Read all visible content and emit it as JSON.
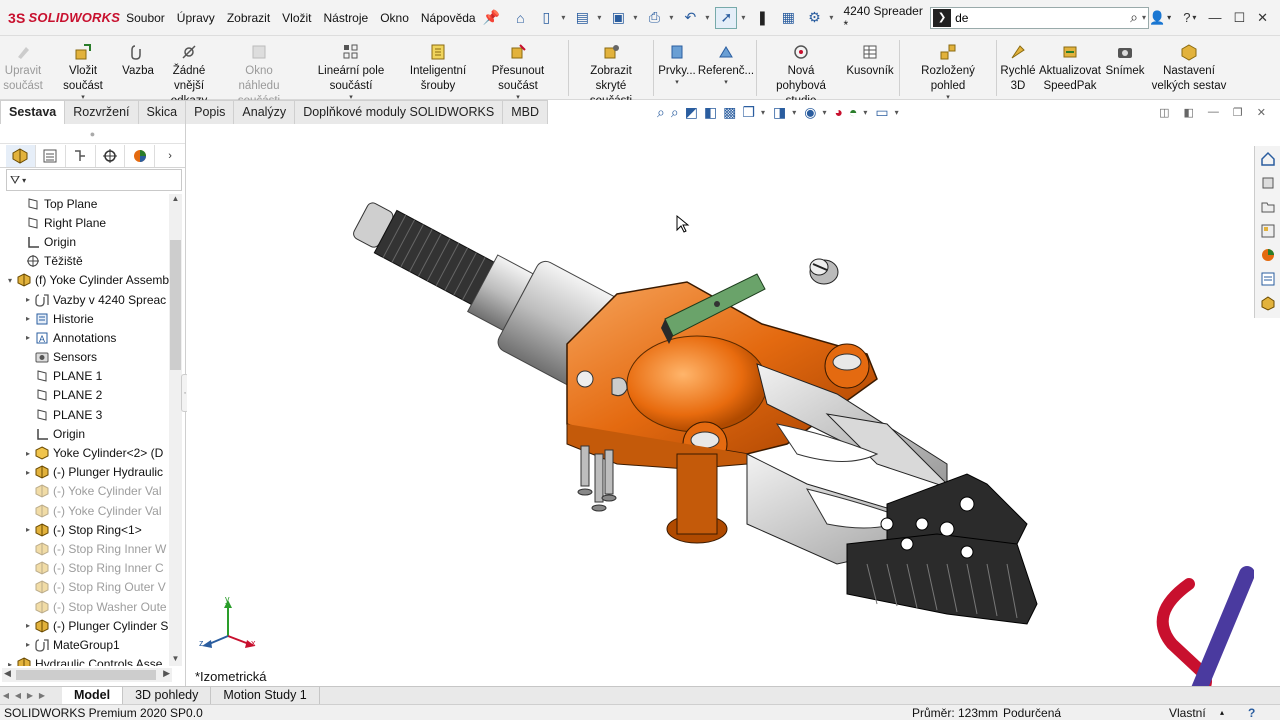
{
  "app": {
    "brand_ds": "3S",
    "brand_name": "SOLIDWORKS"
  },
  "menu": [
    "Soubor",
    "Úpravy",
    "Zobrazit",
    "Vložit",
    "Nástroje",
    "Okno",
    "Nápověda"
  ],
  "document_title": "4240 Spreader *",
  "search": {
    "value": "de"
  },
  "ribbon": [
    {
      "label": "Upravit\nsoučást",
      "disabled": true
    },
    {
      "label": "Vložit součást",
      "disabled": false
    },
    {
      "label": "Vazba",
      "disabled": false
    },
    {
      "label": "Žádné vnější\nodkazy",
      "disabled": false
    },
    {
      "label": "Okno náhledu\nsoučásti",
      "disabled": true
    },
    {
      "label": "Lineární pole součástí",
      "disabled": false
    },
    {
      "label": "Inteligentní\nšrouby",
      "disabled": false
    },
    {
      "label": "Přesunout součást",
      "disabled": false
    },
    {
      "label": "Zobrazit skryté\nsoučásti",
      "disabled": false
    },
    {
      "label": "Prvky...",
      "disabled": false
    },
    {
      "label": "Referenč...",
      "disabled": false
    },
    {
      "label": "Nová pohybová\nstudie",
      "disabled": false
    },
    {
      "label": "Kusovník",
      "disabled": false
    },
    {
      "label": "Rozložený pohled",
      "disabled": false
    },
    {
      "label": "Rychlé\n3D",
      "disabled": false
    },
    {
      "label": "Aktualizovat\nSpeedPak",
      "disabled": false
    },
    {
      "label": "Snímek",
      "disabled": false
    },
    {
      "label": "Nastavení\nvelkých sestav",
      "disabled": false
    }
  ],
  "command_tabs": [
    "Sestava",
    "Rozvržení",
    "Skica",
    "Popis",
    "Analýzy",
    "Doplňkové moduly SOLIDWORKS",
    "MBD"
  ],
  "active_command_tab": "Sestava",
  "tree": [
    {
      "label": "Top Plane",
      "indent": 1,
      "icon": "plane",
      "expander": false,
      "suppressed": false
    },
    {
      "label": "Right Plane",
      "indent": 1,
      "icon": "plane",
      "expander": false,
      "suppressed": false
    },
    {
      "label": "Origin",
      "indent": 1,
      "icon": "origin",
      "expander": false,
      "suppressed": false
    },
    {
      "label": "Těžiště",
      "indent": 1,
      "icon": "com",
      "expander": false,
      "suppressed": false
    },
    {
      "label": "(f) Yoke Cylinder Assembl",
      "indent": 0,
      "icon": "assembly",
      "expander": true,
      "suppressed": false,
      "expanded": true
    },
    {
      "label": "Vazby v 4240 Spreac",
      "indent": 2,
      "icon": "mates",
      "expander": true,
      "suppressed": false
    },
    {
      "label": "Historie",
      "indent": 2,
      "icon": "history",
      "expander": true,
      "suppressed": false
    },
    {
      "label": "Annotations",
      "indent": 2,
      "icon": "annotations",
      "expander": true,
      "suppressed": false
    },
    {
      "label": "Sensors",
      "indent": 2,
      "icon": "sensors",
      "expander": false,
      "suppressed": false
    },
    {
      "label": "PLANE 1",
      "indent": 2,
      "icon": "plane",
      "expander": false,
      "suppressed": false
    },
    {
      "label": "PLANE 2",
      "indent": 2,
      "icon": "plane",
      "expander": false,
      "suppressed": false
    },
    {
      "label": "PLANE 3",
      "indent": 2,
      "icon": "plane",
      "expander": false,
      "suppressed": false
    },
    {
      "label": "Origin",
      "indent": 2,
      "icon": "origin",
      "expander": false,
      "suppressed": false
    },
    {
      "label": "Yoke Cylinder<2> (D",
      "indent": 2,
      "icon": "part",
      "expander": true,
      "suppressed": false
    },
    {
      "label": "(-) Plunger Hydraulic",
      "indent": 2,
      "icon": "assembly",
      "expander": true,
      "suppressed": false
    },
    {
      "label": "(-) Yoke Cylinder Val",
      "indent": 2,
      "icon": "assembly",
      "expander": false,
      "suppressed": true
    },
    {
      "label": "(-) Yoke Cylinder Val",
      "indent": 2,
      "icon": "assembly",
      "expander": false,
      "suppressed": true
    },
    {
      "label": "(-) Stop Ring<1>",
      "indent": 2,
      "icon": "assembly",
      "expander": true,
      "suppressed": false
    },
    {
      "label": "(-) Stop Ring Inner W",
      "indent": 2,
      "icon": "assembly",
      "expander": false,
      "suppressed": true
    },
    {
      "label": "(-) Stop Ring Inner C",
      "indent": 2,
      "icon": "assembly",
      "expander": false,
      "suppressed": true
    },
    {
      "label": "(-) Stop Ring Outer V",
      "indent": 2,
      "icon": "assembly",
      "expander": false,
      "suppressed": true
    },
    {
      "label": "(-) Stop Washer Oute",
      "indent": 2,
      "icon": "assembly",
      "expander": false,
      "suppressed": true
    },
    {
      "label": "(-) Plunger Cylinder S",
      "indent": 2,
      "icon": "assembly",
      "expander": true,
      "suppressed": false
    },
    {
      "label": "MateGroup1",
      "indent": 2,
      "icon": "mates",
      "expander": true,
      "suppressed": false
    },
    {
      "label": "Hydraulic Controls Asse",
      "indent": 0,
      "icon": "assembly",
      "expander": true,
      "suppressed": false
    }
  ],
  "viewport": {
    "orientation_label": "*Izometrická",
    "axis_x": "x",
    "axis_y": "y",
    "axis_z": "z"
  },
  "bottom_tabs": [
    "Model",
    "3D pohledy",
    "Motion Study 1"
  ],
  "active_bottom_tab": "Model",
  "status": {
    "product": "SOLIDWORKS Premium 2020 SP0.0",
    "diameter": "Průměr: 123mm",
    "definition": "Podurčená",
    "units": "Vlastní"
  },
  "colors": {
    "accent": "#2a5d9f",
    "brand_red": "#c8102e",
    "model_orange": "#e46a10"
  }
}
